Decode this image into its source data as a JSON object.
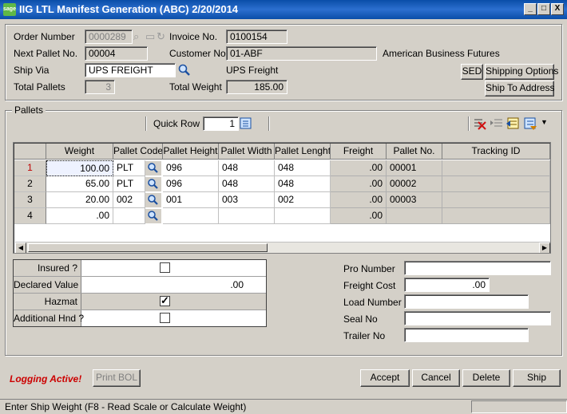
{
  "window": {
    "logo": "sage",
    "title": "IIG LTL Manifest Generation (ABC) 2/20/2014",
    "min_glyph": "_",
    "max_glyph": "□",
    "close_glyph": "X"
  },
  "header": {
    "order_number_label": "Order Number",
    "order_number": "0000289",
    "invoice_no_label": "Invoice No.",
    "invoice_no": "0100154",
    "next_pallet_label": "Next Pallet No.",
    "next_pallet": "00004",
    "customer_no_label": "Customer No.",
    "customer_no": "01-ABF",
    "customer_name": "American Business Futures",
    "ship_via_label": "Ship Via",
    "ship_via": "UPS FREIGHT",
    "ship_via_desc": "UPS Freight",
    "total_pallets_label": "Total Pallets",
    "total_pallets": "3",
    "total_weight_label": "Total Weight",
    "total_weight": "185.00",
    "sed_button": "SED",
    "shipping_options_button": "Shipping Options",
    "ship_to_address_button": "Ship To Address"
  },
  "pallets": {
    "group_label": "Pallets",
    "quick_row_label": "Quick Row",
    "quick_row_value": "1",
    "columns": [
      "Weight",
      "Pallet Code",
      "Pallet Height",
      "Pallet Width",
      "Pallet Lenght",
      "Freight",
      "Pallet No.",
      "Tracking ID"
    ],
    "rows": [
      {
        "num": "1",
        "weight": "100.00",
        "code": "PLT",
        "height": "096",
        "width": "048",
        "length": "048",
        "freight": ".00",
        "pallet_no": "00001",
        "tracking": ""
      },
      {
        "num": "2",
        "weight": "65.00",
        "code": "PLT",
        "height": "096",
        "width": "048",
        "length": "048",
        "freight": ".00",
        "pallet_no": "00002",
        "tracking": ""
      },
      {
        "num": "3",
        "weight": "20.00",
        "code": "002",
        "height": "001",
        "width": "003",
        "length": "002",
        "freight": ".00",
        "pallet_no": "00003",
        "tracking": ""
      },
      {
        "num": "4",
        "weight": ".00",
        "code": "",
        "height": "",
        "width": "",
        "length": "",
        "freight": ".00",
        "pallet_no": "",
        "tracking": ""
      }
    ]
  },
  "options": {
    "insured_label": "Insured ?",
    "declared_value_label": "Declared Value",
    "declared_value": ".00",
    "hazmat_label": "Hazmat",
    "additional_hnd_label": "Additional Hnd ?",
    "check_mark": "✓"
  },
  "shipment": {
    "pro_number_label": "Pro Number",
    "pro_number": "",
    "freight_cost_label": "Freight Cost",
    "freight_cost": ".00",
    "load_number_label": "Load Number",
    "load_number": "",
    "seal_no_label": "Seal No",
    "seal_no": "",
    "trailer_no_label": "Trailer No",
    "trailer_no": ""
  },
  "footer": {
    "logging_text": "Logging Active!",
    "print_bol_button": "Print BOL",
    "accept_button": "Accept",
    "cancel_button": "Cancel",
    "delete_button": "Delete",
    "ship_button": "Ship",
    "status_text": "Enter Ship Weight (F8 - Read Scale or Calculate Weight)"
  },
  "colors": {
    "titlebar": "#0a4ea8",
    "window_bg": "#d4d0c8",
    "logging_text": "#cc0000",
    "sage_logo": "#5fb847"
  }
}
